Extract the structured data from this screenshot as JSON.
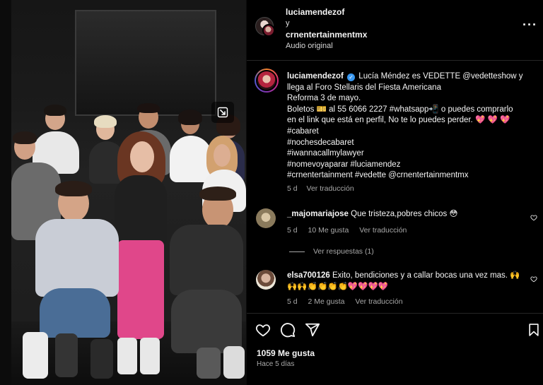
{
  "header": {
    "user1": "luciamendezof",
    "connector": "y",
    "user2": "crnentertainmentmx",
    "audio": "Audio original",
    "more_icon": "more-horizontal-icon"
  },
  "caption": {
    "username": "luciamendezof",
    "lines": [
      "Lucía Méndez es VEDETTE @vedetteshow y",
      "llega al Foro Stellaris del Fiesta Americana",
      "Reforma 3 de mayo.",
      "Boletos 🎫 al 55 6066 2227 #whatsapp📲 o puedes comprarlo",
      "en el link que está en perfil, No te lo puedes perder. 💖 💖 💖",
      "#cabaret",
      "#nochesdecabaret",
      "#iwannacallmylawyer",
      "#nomevoyaparar #luciamendez",
      "#crnentertainment #vedette @crnentertainmentmx"
    ],
    "age": "5 d",
    "translate": "Ver traducción"
  },
  "comments": [
    {
      "username": "_majomariajose",
      "text": "Que tristeza,pobres chicos 😳",
      "age": "5 d",
      "likes": "10 Me gusta",
      "translate": "Ver traducción",
      "replies": "Ver respuestas (1)"
    },
    {
      "username": "elsa700126",
      "text": "Exito, bendiciones y a callar bocas una vez mas. 🙌",
      "text2": "🙌🙌👏👏👏👏💖💖💖💖",
      "age": "5 d",
      "likes": "2 Me gusta",
      "translate": "Ver traducción"
    }
  ],
  "actions": {
    "like_icon": "heart-icon",
    "comment_icon": "comment-icon",
    "share_icon": "share-icon",
    "save_icon": "bookmark-icon",
    "likes": "1059 Me gusta",
    "when": "Hace 5 días"
  },
  "colors": {
    "background": "#000000",
    "text": "#f5f5f5",
    "muted": "#a8a8a8",
    "verified": "#3897f0",
    "divider": "#262626"
  }
}
